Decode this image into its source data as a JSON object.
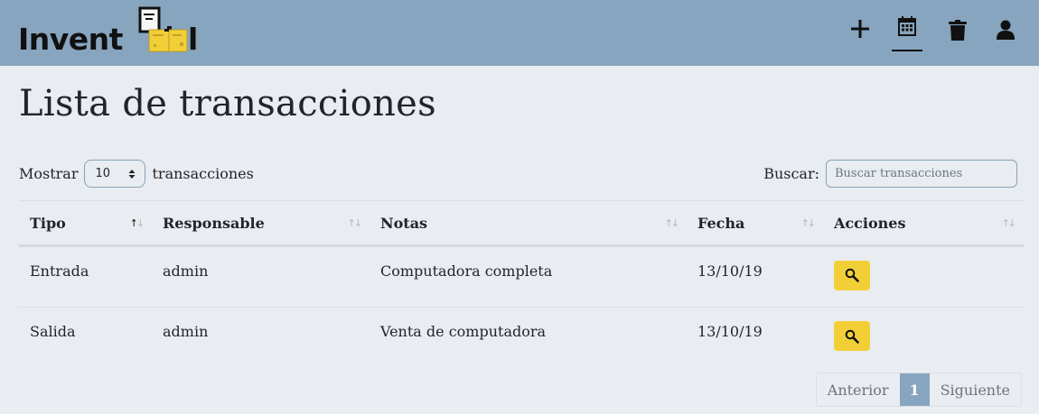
{
  "brand": {
    "text": "Invent",
    "text_end": "l"
  },
  "nav": [
    {
      "icon": "plus-icon"
    },
    {
      "icon": "calendar-icon",
      "active": true
    },
    {
      "icon": "trash-icon"
    },
    {
      "icon": "user-icon"
    }
  ],
  "page": {
    "title": "Lista de transacciones"
  },
  "length": {
    "prefix": "Mostrar",
    "value": "10",
    "suffix": "transacciones"
  },
  "search": {
    "label": "Buscar:",
    "placeholder": "Buscar transacciones"
  },
  "table": {
    "headers": [
      "Tipo",
      "Responsable",
      "Notas",
      "Fecha",
      "Acciones"
    ],
    "rows": [
      {
        "tipo": "Entrada",
        "responsable": "admin",
        "notas": "Computadora completa",
        "fecha": "13/10/19"
      },
      {
        "tipo": "Salida",
        "responsable": "admin",
        "notas": "Venta de computadora",
        "fecha": "13/10/19"
      }
    ]
  },
  "pagination": {
    "prev": "Anterior",
    "current": "1",
    "next": "Siguiente"
  },
  "colors": {
    "navbar": "#87a5bf",
    "background": "#e9ecf0",
    "action_button": "#f2cf37",
    "logo_box": "#f2cf37"
  }
}
